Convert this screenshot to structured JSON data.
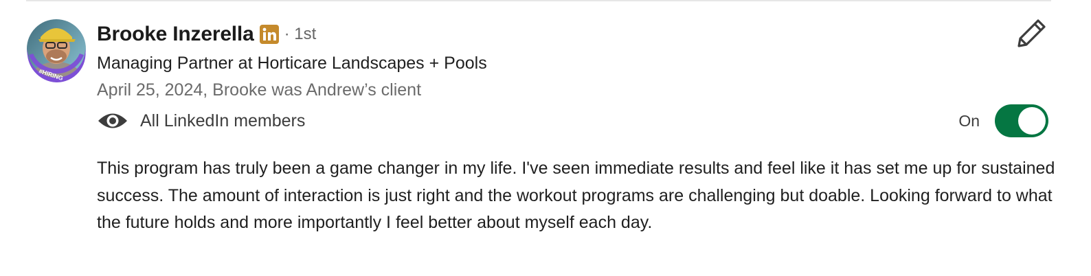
{
  "recommendation_card": {
    "name": "Brooke Inzerella",
    "linkedin_badge": "linkedin-icon",
    "connection_degree": "· 1st",
    "headline": "Managing Partner at Horticare Landscapes + Pools",
    "relationship": "April 25, 2024, Brooke was Andrew’s client",
    "avatar": {
      "frame_text": "#HIRING",
      "frame_color": "#7d4fd6"
    },
    "visibility": {
      "icon": "eye-icon",
      "label": "All LinkedIn members",
      "toggle_state_label": "On",
      "toggle_on": true,
      "toggle_color": "#057642"
    },
    "edit_icon": "pencil-icon",
    "text": "This program has truly been a game changer in my life. I've seen immediate results and feel like it has set me up for sustained success. The amount of interaction is just right and the workout programs are challenging but doable. Looking forward to what the future holds and more importantly I feel better about myself each day."
  }
}
